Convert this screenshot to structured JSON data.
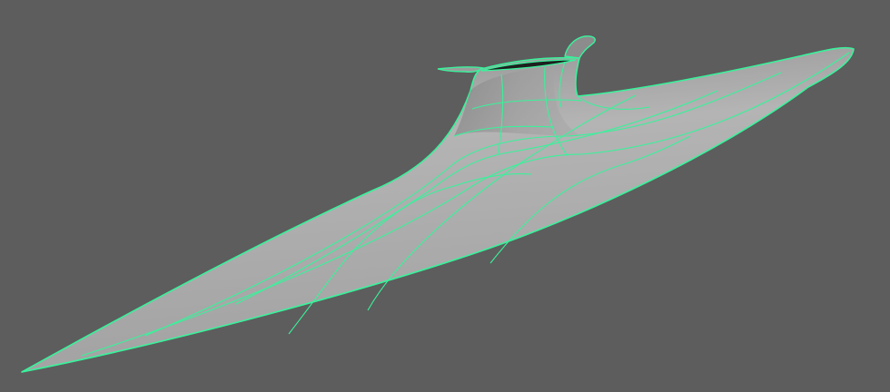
{
  "viewport": {
    "background_color": "#5d5d5d",
    "object": {
      "type": "nurbs-surface",
      "selected": true,
      "wireframe_color": "#39f29b",
      "surface_color": "#a9a9a9",
      "shading": "smooth-shaded",
      "isoparm_count_u": 3,
      "isoparm_count_v": 4
    }
  }
}
